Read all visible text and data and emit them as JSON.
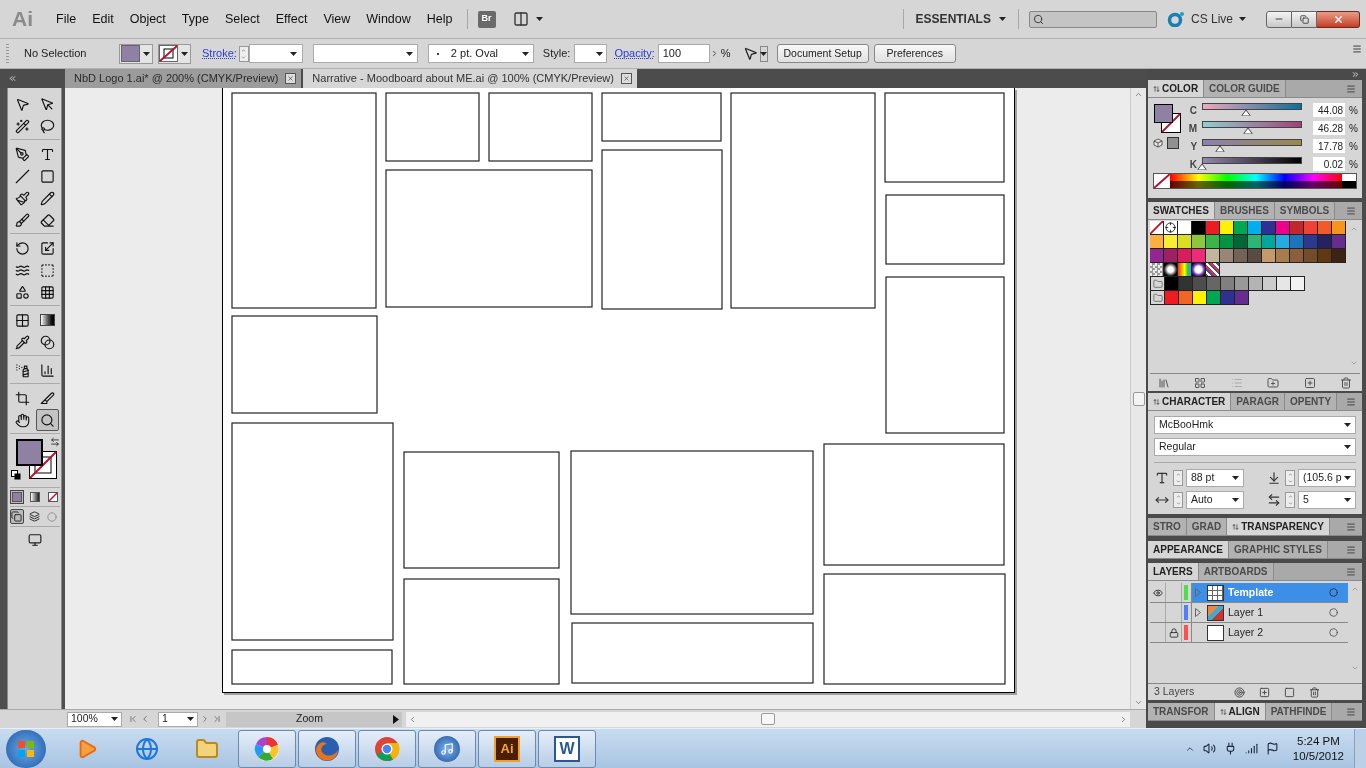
{
  "app": {
    "logo": "Ai",
    "bridge": "Br"
  },
  "menu": [
    "File",
    "Edit",
    "Object",
    "Type",
    "Select",
    "Effect",
    "View",
    "Window",
    "Help"
  ],
  "workspace": "ESSENTIALS",
  "cs_live": "CS Live",
  "control_bar": {
    "selection": "No Selection",
    "stroke_label": "Stroke:",
    "brush": "2 pt. Oval",
    "style_label": "Style:",
    "opacity_label": "Opacity:",
    "opacity": "100",
    "percent": "%",
    "buttons": [
      "Document Setup",
      "Preferences"
    ]
  },
  "doc_tabs": [
    {
      "label": "NbD Logo 1.ai* @ 200% (CMYK/Preview)",
      "selected": false
    },
    {
      "label": "Narrative - Moodboard about ME.ai @ 100% (CMYK/Preview)",
      "selected": true
    }
  ],
  "toolbox": {
    "tools": [
      {
        "kind": "selection",
        "selected": false
      },
      {
        "kind": "direct-selection",
        "selected": false
      },
      {
        "kind": "magic-wand",
        "selected": false
      },
      {
        "kind": "lasso",
        "selected": false
      },
      {
        "kind": "pen",
        "selected": false
      },
      {
        "kind": "type",
        "selected": false
      },
      {
        "kind": "line",
        "selected": false
      },
      {
        "kind": "rectangle",
        "selected": false
      },
      {
        "kind": "paintbrush",
        "selected": false
      },
      {
        "kind": "pencil",
        "selected": false
      },
      {
        "kind": "blob-brush",
        "selected": false
      },
      {
        "kind": "eraser",
        "selected": false
      },
      {
        "kind": "rotate",
        "selected": false
      },
      {
        "kind": "scale",
        "selected": false
      },
      {
        "kind": "warp",
        "selected": false
      },
      {
        "kind": "free-transform",
        "selected": false
      },
      {
        "kind": "shape-builder",
        "selected": false
      },
      {
        "kind": "perspective",
        "selected": false
      },
      {
        "kind": "mesh",
        "selected": false
      },
      {
        "kind": "gradient",
        "selected": false
      },
      {
        "kind": "eyedropper",
        "selected": false
      },
      {
        "kind": "blend",
        "selected": false
      },
      {
        "kind": "symbol-sprayer",
        "selected": false
      },
      {
        "kind": "graph",
        "selected": false
      },
      {
        "kind": "artboard",
        "selected": false
      },
      {
        "kind": "slice",
        "selected": false
      },
      {
        "kind": "hand",
        "selected": false
      },
      {
        "kind": "zoom",
        "selected": true
      }
    ],
    "fill_modes": [
      {
        "kind": "color",
        "selected": true
      },
      {
        "kind": "gradient",
        "selected": false
      },
      {
        "kind": "none",
        "selected": false
      }
    ],
    "draw_modes": [
      {
        "kind": "normal",
        "selected": true
      },
      {
        "kind": "behind",
        "selected": false
      },
      {
        "kind": "inside",
        "selected": false
      }
    ]
  },
  "color_panel": {
    "tabs": [
      {
        "label": "COLOR",
        "selected": true,
        "toggle": true
      },
      {
        "label": "COLOR GUIDE",
        "selected": false,
        "toggle": false
      }
    ],
    "channels": [
      {
        "name": "C",
        "level": 0.4408,
        "value": "44.08",
        "unit": "%"
      },
      {
        "name": "M",
        "level": 0.4628,
        "value": "46.28",
        "unit": "%"
      },
      {
        "name": "Y",
        "level": 0.1778,
        "value": "17.78",
        "unit": "%"
      },
      {
        "name": "K",
        "level": 0.0002,
        "value": "0.02",
        "unit": "%"
      }
    ]
  },
  "swatches_panel": {
    "tabs": [
      {
        "label": "SWATCHES",
        "selected": true,
        "toggle": false
      },
      {
        "label": "BRUSHES",
        "selected": false,
        "toggle": false
      },
      {
        "label": "SYMBOLS",
        "selected": false,
        "toggle": false
      }
    ],
    "rows": [
      {
        "kind": "plain",
        "swatches": [
          {
            "kind": "none"
          },
          {
            "kind": "registration"
          },
          {
            "kind": "color",
            "color": "#ffffff"
          },
          {
            "kind": "color",
            "color": "#000000"
          },
          {
            "kind": "color",
            "color": "#ed1c24"
          },
          {
            "kind": "color",
            "color": "#fff200"
          },
          {
            "kind": "color",
            "color": "#00a651"
          },
          {
            "kind": "color",
            "color": "#00aeef"
          },
          {
            "kind": "color",
            "color": "#2e3192"
          },
          {
            "kind": "color",
            "color": "#ec008c"
          },
          {
            "kind": "color",
            "color": "#c1272d"
          },
          {
            "kind": "color",
            "color": "#ef4136"
          },
          {
            "kind": "color",
            "color": "#f15a29"
          },
          {
            "kind": "color",
            "color": "#f7941d"
          }
        ]
      },
      {
        "kind": "plain",
        "swatches": [
          {
            "kind": "color",
            "color": "#fbb040"
          },
          {
            "kind": "color",
            "color": "#f9ed32"
          },
          {
            "kind": "color",
            "color": "#d7df23"
          },
          {
            "kind": "color",
            "color": "#8dc63f"
          },
          {
            "kind": "color",
            "color": "#39b54a"
          },
          {
            "kind": "color",
            "color": "#009444"
          },
          {
            "kind": "color",
            "color": "#006838"
          },
          {
            "kind": "color",
            "color": "#2bb673"
          },
          {
            "kind": "color",
            "color": "#00a79d"
          },
          {
            "kind": "color",
            "color": "#27aae1"
          },
          {
            "kind": "color",
            "color": "#1c75bc"
          },
          {
            "kind": "color",
            "color": "#2b3990"
          },
          {
            "kind": "color",
            "color": "#262262"
          },
          {
            "kind": "color",
            "color": "#662d91"
          }
        ]
      },
      {
        "kind": "plain",
        "swatches": [
          {
            "kind": "color",
            "color": "#92278f"
          },
          {
            "kind": "color",
            "color": "#9e1f63"
          },
          {
            "kind": "color",
            "color": "#da1c5c"
          },
          {
            "kind": "color",
            "color": "#ee2a7b"
          },
          {
            "kind": "color",
            "color": "#c2b59b"
          },
          {
            "kind": "color",
            "color": "#998675"
          },
          {
            "kind": "color",
            "color": "#736357"
          },
          {
            "kind": "color",
            "color": "#594a42"
          },
          {
            "kind": "color",
            "color": "#c49a6c"
          },
          {
            "kind": "color",
            "color": "#a97c50"
          },
          {
            "kind": "color",
            "color": "#8b5e3c"
          },
          {
            "kind": "color",
            "color": "#754c29"
          },
          {
            "kind": "color",
            "color": "#603913"
          },
          {
            "kind": "color",
            "color": "#3c2415"
          }
        ]
      },
      {
        "kind": "plain",
        "swatches": [
          {
            "kind": "fade"
          },
          {
            "kind": "radial"
          },
          {
            "kind": "rainbow"
          },
          {
            "kind": "glow"
          },
          {
            "kind": "pattern"
          }
        ]
      },
      {
        "kind": "group",
        "swatches": [
          {
            "kind": "color",
            "color": "#000000"
          },
          {
            "kind": "color",
            "color": "#333333"
          },
          {
            "kind": "color",
            "color": "#4d4d4d"
          },
          {
            "kind": "color",
            "color": "#666666"
          },
          {
            "kind": "color",
            "color": "#808080"
          },
          {
            "kind": "color",
            "color": "#999999"
          },
          {
            "kind": "color",
            "color": "#b3b3b3"
          },
          {
            "kind": "color",
            "color": "#cccccc"
          },
          {
            "kind": "color",
            "color": "#e6e6e6"
          },
          {
            "kind": "color",
            "color": "#f2f2f2"
          }
        ]
      },
      {
        "kind": "group",
        "swatches": [
          {
            "kind": "color",
            "color": "#ed1c24"
          },
          {
            "kind": "color",
            "color": "#f26522"
          },
          {
            "kind": "color",
            "color": "#fff200"
          },
          {
            "kind": "color",
            "color": "#00a651"
          },
          {
            "kind": "color",
            "color": "#2e3192"
          },
          {
            "kind": "color",
            "color": "#662d91"
          }
        ]
      }
    ]
  },
  "character_panel": {
    "tabs": [
      {
        "label": "CHARACTER",
        "selected": true,
        "toggle": true
      },
      {
        "label": "PARAGR",
        "selected": false,
        "toggle": false
      },
      {
        "label": "OPENTY",
        "selected": false,
        "toggle": false
      }
    ],
    "font": "McBooHmk",
    "style": "Regular",
    "size": "88 pt",
    "leading": "(105.6 p",
    "kerning": "Auto",
    "tracking": "5"
  },
  "transparency_panel": {
    "tabs": [
      {
        "label": "STRO",
        "selected": false,
        "toggle": false
      },
      {
        "label": "GRAD",
        "selected": false,
        "toggle": false
      },
      {
        "label": "TRANSPARENCY",
        "selected": true,
        "toggle": true
      }
    ]
  },
  "appearance_panel": {
    "tabs": [
      {
        "label": "APPEARANCE",
        "selected": true,
        "toggle": false
      },
      {
        "label": "GRAPHIC STYLES",
        "selected": false,
        "toggle": false
      }
    ]
  },
  "layers_panel": {
    "tabs": [
      {
        "label": "LAYERS",
        "selected": true,
        "toggle": false
      },
      {
        "label": "ARTBOARDS",
        "selected": false,
        "toggle": false
      }
    ],
    "layers": [
      {
        "name": "Template",
        "kind": "template",
        "selected": true,
        "visible": true,
        "locked": false,
        "expandable": true,
        "color": "#4fdc4f"
      },
      {
        "name": "Layer 1",
        "kind": "image",
        "selected": false,
        "visible": false,
        "locked": false,
        "expandable": true,
        "color": "#4f7fff"
      },
      {
        "name": "Layer 2",
        "kind": "empty",
        "selected": false,
        "visible": false,
        "locked": true,
        "expandable": false,
        "color": "#ff4f4f"
      }
    ],
    "count": "3 Layers"
  },
  "align_panel": {
    "tabs": [
      {
        "label": "TRANSFOR",
        "selected": false,
        "toggle": false
      },
      {
        "label": "ALIGN",
        "selected": true,
        "toggle": true
      },
      {
        "label": "PATHFINDE",
        "selected": false,
        "toggle": false
      }
    ]
  },
  "status_bar": {
    "zoom": "100%",
    "artboard": "1",
    "tool": "Zoom"
  },
  "taskbar": {
    "apps": [
      {
        "kind": "media-player",
        "running": false
      },
      {
        "kind": "ie",
        "running": false
      },
      {
        "kind": "explorer",
        "running": false
      },
      {
        "kind": "picasa",
        "running": true
      },
      {
        "kind": "firefox",
        "running": true
      },
      {
        "kind": "chrome",
        "running": true
      },
      {
        "kind": "itunes",
        "running": true
      },
      {
        "kind": "illustrator",
        "label": "Ai",
        "running": true
      },
      {
        "kind": "word",
        "label": "W",
        "running": true
      }
    ],
    "time": "5:24 PM",
    "date": "10/5/2012"
  }
}
